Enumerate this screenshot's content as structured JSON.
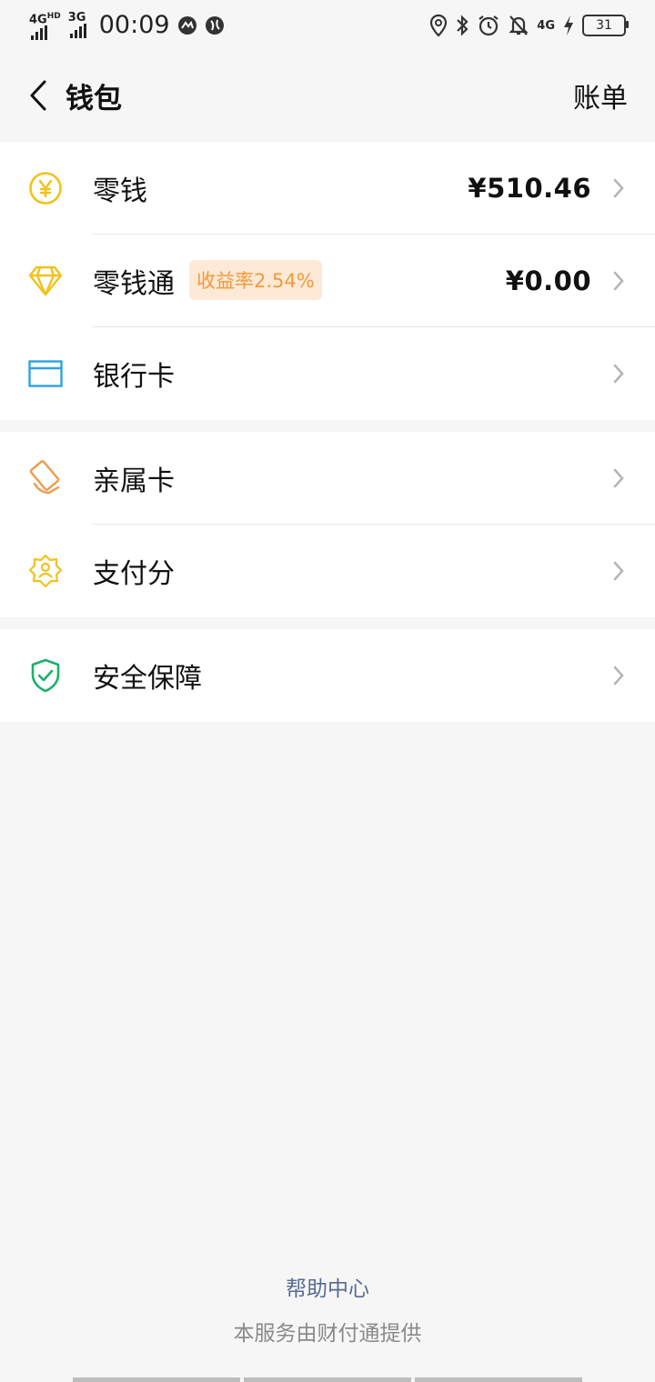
{
  "status_bar": {
    "network_1": "4G",
    "network_1_sup": "HD",
    "network_2": "3G",
    "time": "00:09",
    "network_3": "4G",
    "battery": "31"
  },
  "header": {
    "title": "钱包",
    "right_action": "账单"
  },
  "groups": [
    {
      "items": [
        {
          "label": "零钱",
          "value": "¥510.46",
          "icon": "yuan-coin-icon"
        },
        {
          "label": "零钱通",
          "badge": "收益率2.54%",
          "value": "¥0.00",
          "icon": "diamond-icon"
        },
        {
          "label": "银行卡",
          "icon": "bank-card-icon"
        }
      ]
    },
    {
      "items": [
        {
          "label": "亲属卡",
          "icon": "family-card-icon"
        },
        {
          "label": "支付分",
          "icon": "credit-score-icon"
        }
      ]
    },
    {
      "items": [
        {
          "label": "安全保障",
          "icon": "shield-check-icon"
        }
      ]
    }
  ],
  "footer": {
    "help_link": "帮助中心",
    "provider_text": "本服务由财付通提供"
  },
  "colors": {
    "yellow_icon": "#f1c21b",
    "blue_icon": "#2ba3e6",
    "orange_icon": "#ee9a4c",
    "green_icon": "#1db06a",
    "badge_bg": "#fde9d6",
    "badge_text": "#f09a3b",
    "link": "#586c94"
  }
}
